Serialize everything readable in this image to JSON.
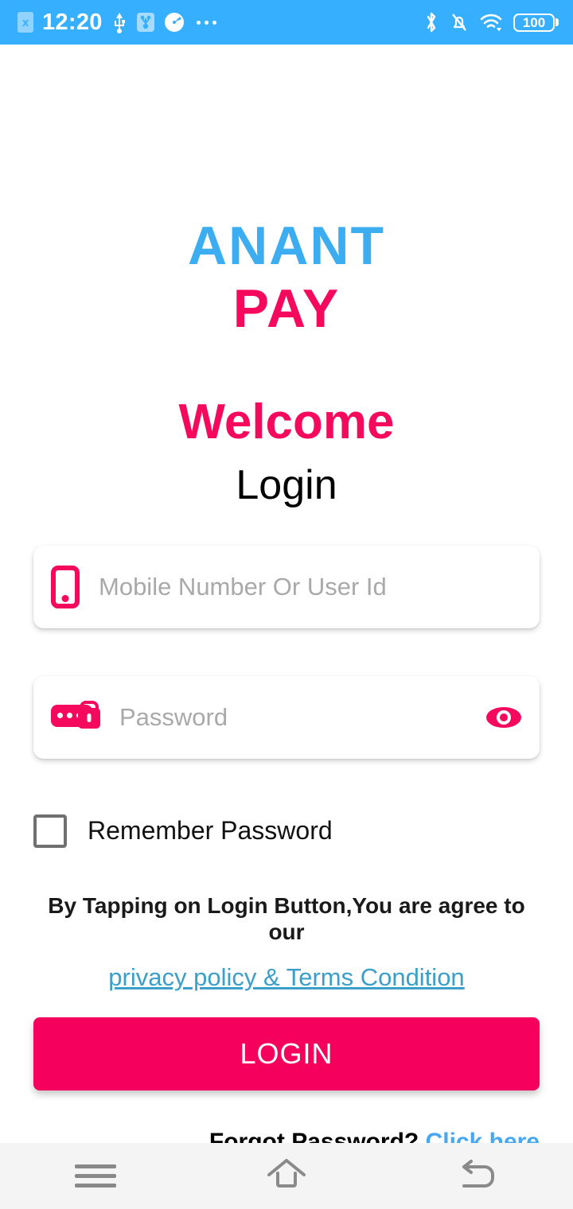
{
  "statusbar": {
    "time": "12:20",
    "sim_badge": "x",
    "battery_level": "100",
    "icons": [
      "sim-card-x-icon",
      "usb-icon",
      "adb-debug-icon",
      "speedometer-icon",
      "more-dots-icon",
      "bluetooth-icon",
      "bell-muted-icon",
      "wifi-icon",
      "battery-icon"
    ]
  },
  "logo": {
    "line1": "ANANT",
    "line2": "PAY",
    "line1_color": "#3CADF0",
    "line2_color": "#F4095C"
  },
  "headings": {
    "welcome": "Welcome",
    "login": "Login"
  },
  "form": {
    "mobile": {
      "placeholder": "Mobile Number Or User Id",
      "value": "",
      "icon": "mobile-phone-icon"
    },
    "password": {
      "placeholder": "Password",
      "value": "",
      "icon": "password-lock-icon",
      "toggle_icon": "eye-icon"
    },
    "remember": {
      "label": "Remember Password",
      "checked": false
    }
  },
  "terms": {
    "text": "By Tapping on Login Button,You are agree to our",
    "link": "privacy policy & Terms Condition",
    "link_color": "#3B9FC9"
  },
  "actions": {
    "login_label": "LOGIN",
    "login_color": "#F5005C"
  },
  "forgot": {
    "text": "Forgot Password? ",
    "link": "Click here",
    "link_color": "#47A8F0"
  },
  "navbar": {
    "menu": "menu-icon",
    "home": "home-icon",
    "back": "back-icon"
  }
}
